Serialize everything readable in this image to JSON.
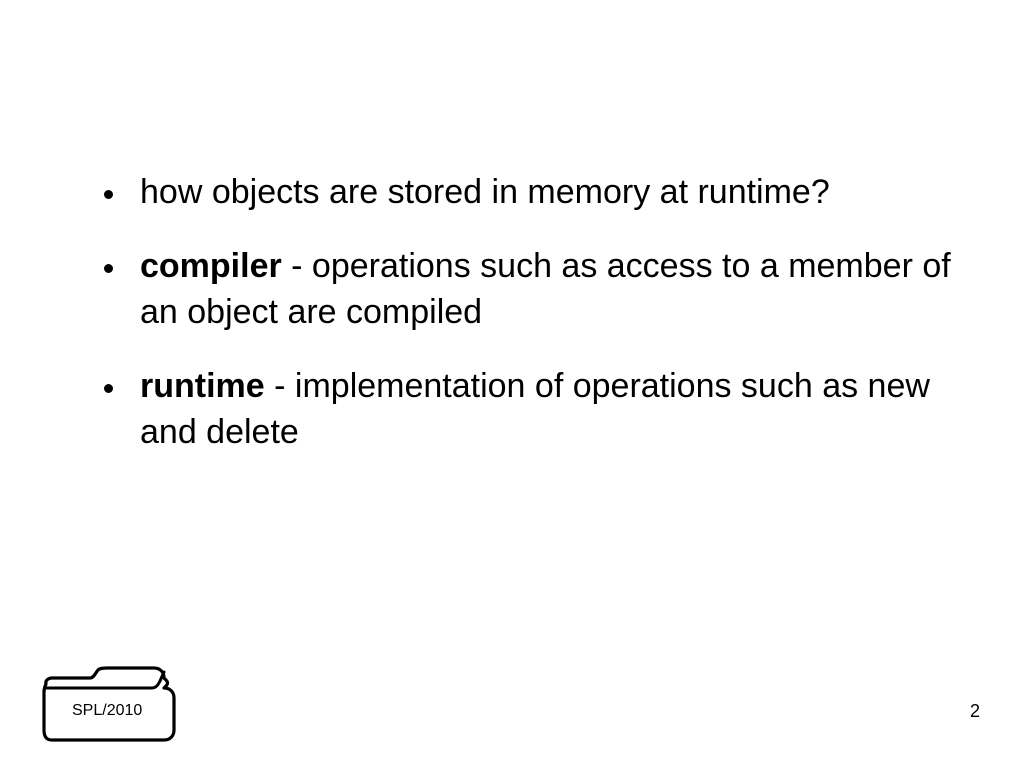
{
  "bullets": [
    {
      "prefix": "",
      "text": "how objects are stored in memory at runtime?"
    },
    {
      "prefix": "compiler",
      "text": " - operations such as access to a member of an object are compiled"
    },
    {
      "prefix": "runtime",
      "text": " - implementation of operations such as new and delete"
    }
  ],
  "footer": {
    "folder_label": "SPL/2010",
    "page_number": "2"
  }
}
